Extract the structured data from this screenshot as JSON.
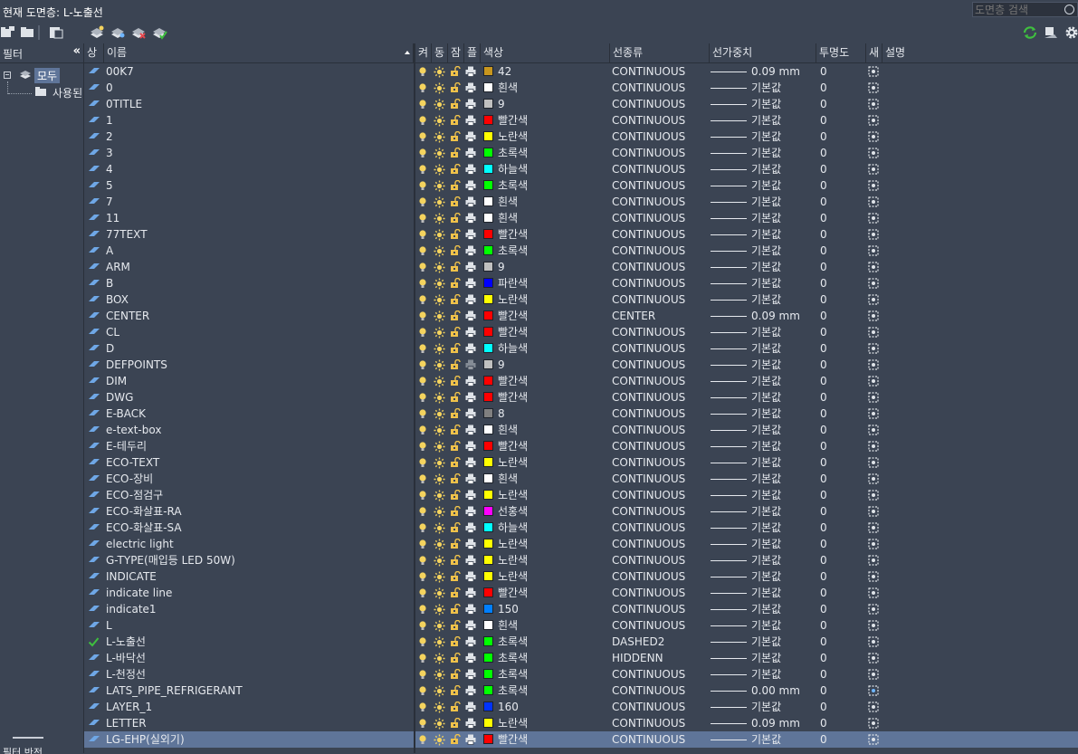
{
  "window": {
    "title": "현재 도면층: L-노출선"
  },
  "search": {
    "placeholder": "도면층 검색"
  },
  "sidebar": {
    "header_label": "필터",
    "collapse_glyph": "«",
    "tree": [
      {
        "label": "모두"
      },
      {
        "label": "사용된 모든 도면층"
      }
    ],
    "bottom_label": "필터 반전"
  },
  "columns": [
    "상",
    "이름",
    "켜",
    "동",
    "잠",
    "플",
    "색상",
    "선종류",
    "선가중치",
    "투명도",
    "새",
    "설명"
  ],
  "colors": {
    "accent_selected": "#5f7599",
    "bulb": "#f4d35e",
    "sun": "#f4d35e",
    "lock": "#f0c24a",
    "check": "#3fbf3f"
  },
  "layers": [
    {
      "name": "00K7",
      "color_name": "42",
      "color": "#c8961e",
      "linetype": "CONTINUOUS",
      "lineweight": "0.09 mm",
      "transparency": "0"
    },
    {
      "name": "0",
      "color_name": "흰색",
      "color": "#ffffff",
      "linetype": "CONTINUOUS",
      "lineweight": "기본값",
      "transparency": "0"
    },
    {
      "name": "0TITLE",
      "color_name": "9",
      "color": "#c0c0c0",
      "linetype": "CONTINUOUS",
      "lineweight": "기본값",
      "transparency": "0"
    },
    {
      "name": "1",
      "color_name": "빨간색",
      "color": "#ff0000",
      "linetype": "CONTINUOUS",
      "lineweight": "기본값",
      "transparency": "0"
    },
    {
      "name": "2",
      "color_name": "노란색",
      "color": "#ffff00",
      "linetype": "CONTINUOUS",
      "lineweight": "기본값",
      "transparency": "0"
    },
    {
      "name": "3",
      "color_name": "초록색",
      "color": "#00ff00",
      "linetype": "CONTINUOUS",
      "lineweight": "기본값",
      "transparency": "0"
    },
    {
      "name": "4",
      "color_name": "하늘색",
      "color": "#00ffff",
      "linetype": "CONTINUOUS",
      "lineweight": "기본값",
      "transparency": "0"
    },
    {
      "name": "5",
      "color_name": "초록색",
      "color": "#00ff00",
      "linetype": "CONTINUOUS",
      "lineweight": "기본값",
      "transparency": "0"
    },
    {
      "name": "7",
      "color_name": "흰색",
      "color": "#ffffff",
      "linetype": "CONTINUOUS",
      "lineweight": "기본값",
      "transparency": "0"
    },
    {
      "name": "11",
      "color_name": "흰색",
      "color": "#ffffff",
      "linetype": "CONTINUOUS",
      "lineweight": "기본값",
      "transparency": "0"
    },
    {
      "name": "77TEXT",
      "color_name": "빨간색",
      "color": "#ff0000",
      "linetype": "CONTINUOUS",
      "lineweight": "기본값",
      "transparency": "0"
    },
    {
      "name": "A",
      "color_name": "초록색",
      "color": "#00ff00",
      "linetype": "CONTINUOUS",
      "lineweight": "기본값",
      "transparency": "0"
    },
    {
      "name": "ARM",
      "color_name": "9",
      "color": "#c0c0c0",
      "linetype": "CONTINUOUS",
      "lineweight": "기본값",
      "transparency": "0"
    },
    {
      "name": "B",
      "color_name": "파란색",
      "color": "#0000ff",
      "linetype": "CONTINUOUS",
      "lineweight": "기본값",
      "transparency": "0"
    },
    {
      "name": "BOX",
      "color_name": "노란색",
      "color": "#ffff00",
      "linetype": "CONTINUOUS",
      "lineweight": "기본값",
      "transparency": "0"
    },
    {
      "name": "CENTER",
      "color_name": "빨간색",
      "color": "#ff0000",
      "linetype": "CENTER",
      "lineweight": "0.09 mm",
      "transparency": "0"
    },
    {
      "name": "CL",
      "color_name": "빨간색",
      "color": "#ff0000",
      "linetype": "CONTINUOUS",
      "lineweight": "기본값",
      "transparency": "0"
    },
    {
      "name": "D",
      "color_name": "하늘색",
      "color": "#00ffff",
      "linetype": "CONTINUOUS",
      "lineweight": "기본값",
      "transparency": "0"
    },
    {
      "name": "DEFPOINTS",
      "color_name": "9",
      "color": "#c0c0c0",
      "linetype": "CONTINUOUS",
      "lineweight": "기본값",
      "transparency": "0",
      "no_plot": true
    },
    {
      "name": "DIM",
      "color_name": "빨간색",
      "color": "#ff0000",
      "linetype": "CONTINUOUS",
      "lineweight": "기본값",
      "transparency": "0"
    },
    {
      "name": "DWG",
      "color_name": "빨간색",
      "color": "#ff0000",
      "linetype": "CONTINUOUS",
      "lineweight": "기본값",
      "transparency": "0"
    },
    {
      "name": "E-BACK",
      "color_name": "8",
      "color": "#808080",
      "linetype": "CONTINUOUS",
      "lineweight": "기본값",
      "transparency": "0"
    },
    {
      "name": "e-text-box",
      "color_name": "흰색",
      "color": "#ffffff",
      "linetype": "CONTINUOUS",
      "lineweight": "기본값",
      "transparency": "0"
    },
    {
      "name": "E-테두리",
      "color_name": "빨간색",
      "color": "#ff0000",
      "linetype": "CONTINUOUS",
      "lineweight": "기본값",
      "transparency": "0"
    },
    {
      "name": "ECO-TEXT",
      "color_name": "노란색",
      "color": "#ffff00",
      "linetype": "CONTINUOUS",
      "lineweight": "기본값",
      "transparency": "0"
    },
    {
      "name": "ECO-장비",
      "color_name": "흰색",
      "color": "#ffffff",
      "linetype": "CONTINUOUS",
      "lineweight": "기본값",
      "transparency": "0"
    },
    {
      "name": "ECO-점검구",
      "color_name": "노란색",
      "color": "#ffff00",
      "linetype": "CONTINUOUS",
      "lineweight": "기본값",
      "transparency": "0"
    },
    {
      "name": "ECO-화살표-RA",
      "color_name": "선홍색",
      "color": "#ff00ff",
      "linetype": "CONTINUOUS",
      "lineweight": "기본값",
      "transparency": "0"
    },
    {
      "name": "ECO-화살표-SA",
      "color_name": "하늘색",
      "color": "#00ffff",
      "linetype": "CONTINUOUS",
      "lineweight": "기본값",
      "transparency": "0"
    },
    {
      "name": "electric light",
      "color_name": "노란색",
      "color": "#ffff00",
      "linetype": "CONTINUOUS",
      "lineweight": "기본값",
      "transparency": "0"
    },
    {
      "name": "G-TYPE(매입등 LED 50W)",
      "color_name": "노란색",
      "color": "#ffff00",
      "linetype": "CONTINUOUS",
      "lineweight": "기본값",
      "transparency": "0"
    },
    {
      "name": "INDICATE",
      "color_name": "노란색",
      "color": "#ffff00",
      "linetype": "CONTINUOUS",
      "lineweight": "기본값",
      "transparency": "0"
    },
    {
      "name": "indicate line",
      "color_name": "빨간색",
      "color": "#ff0000",
      "linetype": "CONTINUOUS",
      "lineweight": "기본값",
      "transparency": "0"
    },
    {
      "name": "indicate1",
      "color_name": "150",
      "color": "#007fff",
      "linetype": "CONTINUOUS",
      "lineweight": "기본값",
      "transparency": "0"
    },
    {
      "name": "L",
      "color_name": "흰색",
      "color": "#ffffff",
      "linetype": "CONTINUOUS",
      "lineweight": "기본값",
      "transparency": "0"
    },
    {
      "name": "L-노출선",
      "color_name": "초록색",
      "color": "#00ff00",
      "linetype": "DASHED2",
      "lineweight": "기본값",
      "transparency": "0",
      "current": true
    },
    {
      "name": "L-바닥선",
      "color_name": "초록색",
      "color": "#00ff00",
      "linetype": "HIDDENN",
      "lineweight": "기본값",
      "transparency": "0"
    },
    {
      "name": "L-천정선",
      "color_name": "초록색",
      "color": "#00ff00",
      "linetype": "CONTINUOUS",
      "lineweight": "기본값",
      "transparency": "0"
    },
    {
      "name": "LATS_PIPE_REFRIGERANT",
      "color_name": "초록색",
      "color": "#00ff00",
      "linetype": "CONTINUOUS",
      "lineweight": "0.00 mm",
      "transparency": "0",
      "nvp_alt": true
    },
    {
      "name": "LAYER_1",
      "color_name": "160",
      "color": "#0033ff",
      "linetype": "CONTINUOUS",
      "lineweight": "기본값",
      "transparency": "0"
    },
    {
      "name": "LETTER",
      "color_name": "노란색",
      "color": "#ffff00",
      "linetype": "CONTINUOUS",
      "lineweight": "0.09 mm",
      "transparency": "0"
    },
    {
      "name": "LG-EHP(실외기)",
      "color_name": "빨간색",
      "color": "#ff0000",
      "linetype": "CONTINUOUS",
      "lineweight": "기본값",
      "transparency": "0",
      "selected": true
    }
  ]
}
